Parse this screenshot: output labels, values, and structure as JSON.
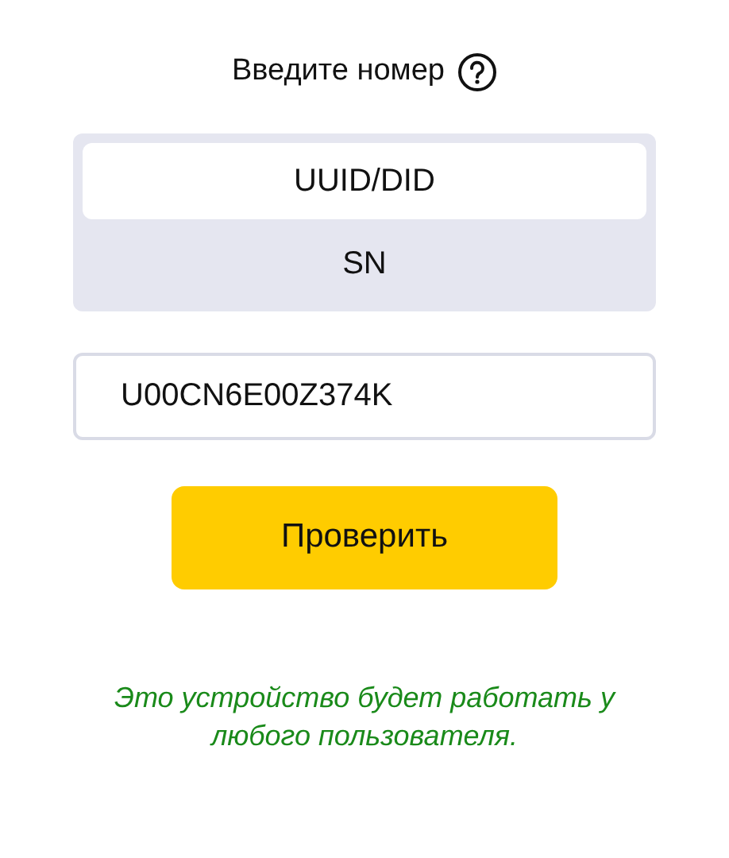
{
  "title": "Введите номер",
  "segments": [
    {
      "label": "UUID/DID",
      "selected": true
    },
    {
      "label": "SN",
      "selected": false
    }
  ],
  "input": {
    "value": "U00CN6E00Z374K"
  },
  "button": {
    "label": "Проверить"
  },
  "message": "Это устройство будет работать у любого пользователя."
}
